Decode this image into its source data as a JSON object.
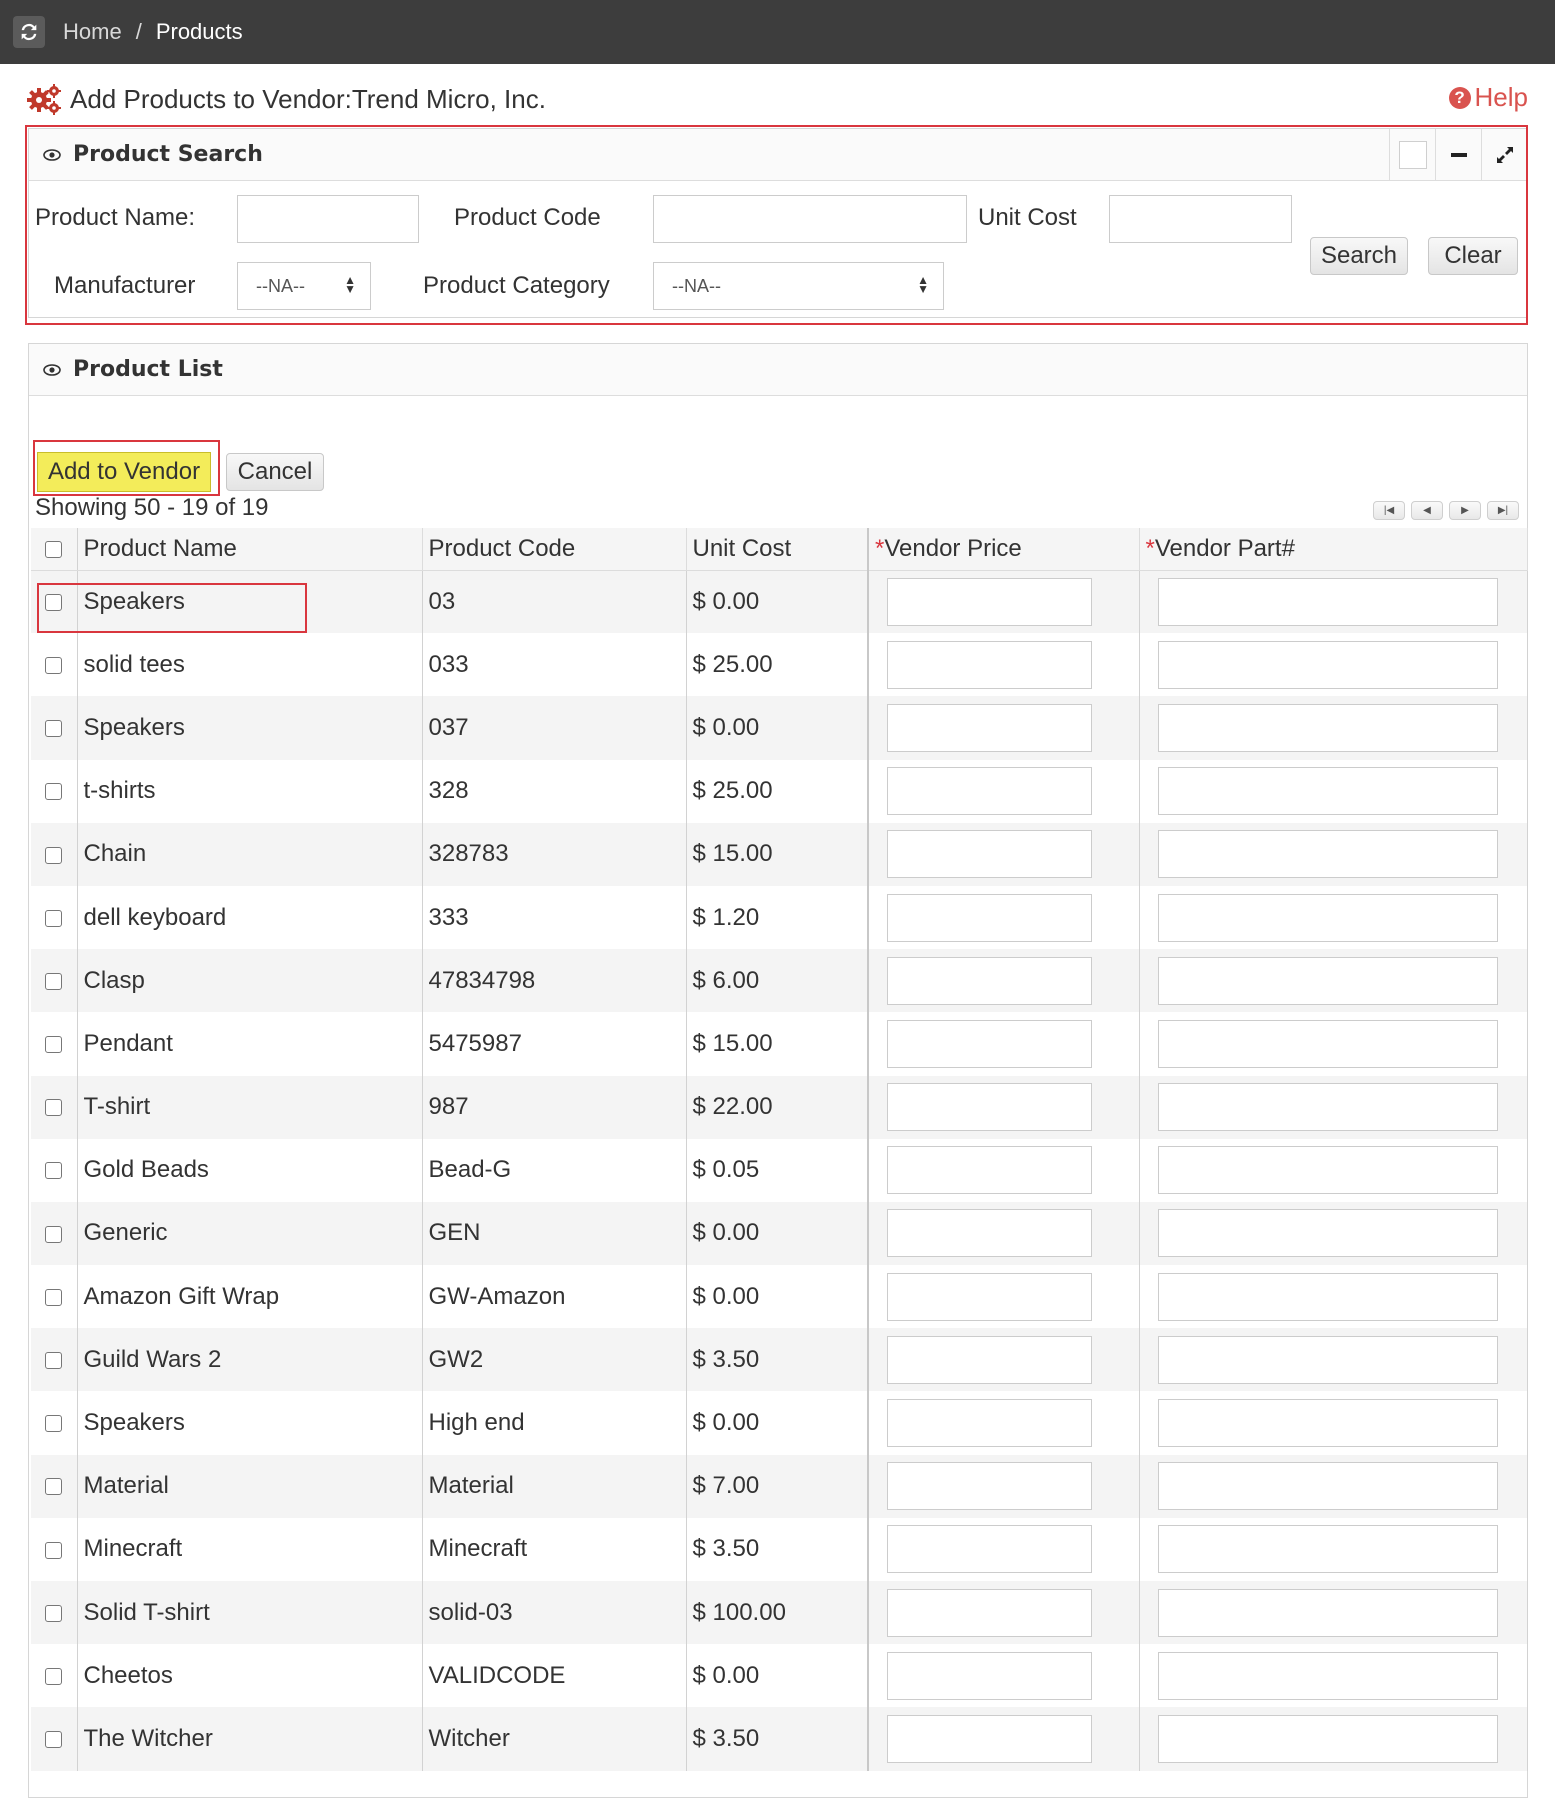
{
  "breadcrumb": {
    "home": "Home",
    "separator": "/",
    "current": "Products"
  },
  "page": {
    "title": "Add Products to Vendor:Trend Micro, Inc.",
    "help": "Help"
  },
  "search_panel": {
    "title": "Product Search",
    "labels": {
      "product_name": "Product Name:",
      "product_code": "Product Code",
      "unit_cost": "Unit Cost",
      "manufacturer": "Manufacturer",
      "product_category": "Product Category"
    },
    "manufacturer_value": "--NA--",
    "category_value": "--NA--",
    "search_button": "Search",
    "clear_button": "Clear"
  },
  "list_panel": {
    "title": "Product List",
    "add_button": "Add to Vendor",
    "cancel_button": "Cancel",
    "showing": "Showing 50 - 19 of 19",
    "columns": {
      "product_name": "Product Name",
      "product_code": "Product Code",
      "unit_cost": "Unit Cost",
      "required_mark": "*",
      "vendor_price": "Vendor Price",
      "vendor_part": "Vendor Part#"
    },
    "rows": [
      {
        "name": "Speakers",
        "code": "03",
        "cost": "$ 0.00"
      },
      {
        "name": "solid tees",
        "code": "033",
        "cost": "$ 25.00"
      },
      {
        "name": "Speakers",
        "code": "037",
        "cost": "$ 0.00"
      },
      {
        "name": "t-shirts",
        "code": "328",
        "cost": "$ 25.00"
      },
      {
        "name": "Chain",
        "code": "328783",
        "cost": "$ 15.00"
      },
      {
        "name": "dell keyboard",
        "code": "333",
        "cost": "$ 1.20"
      },
      {
        "name": "Clasp",
        "code": "47834798",
        "cost": "$ 6.00"
      },
      {
        "name": "Pendant",
        "code": "5475987",
        "cost": "$ 15.00"
      },
      {
        "name": "T-shirt",
        "code": "987",
        "cost": "$ 22.00"
      },
      {
        "name": "Gold Beads",
        "code": "Bead-G",
        "cost": "$ 0.05"
      },
      {
        "name": "Generic",
        "code": "GEN",
        "cost": "$ 0.00"
      },
      {
        "name": "Amazon Gift Wrap",
        "code": "GW-Amazon",
        "cost": "$ 0.00"
      },
      {
        "name": "Guild Wars 2",
        "code": "GW2",
        "cost": "$ 3.50"
      },
      {
        "name": "Speakers",
        "code": "High end",
        "cost": "$ 0.00"
      },
      {
        "name": "Material",
        "code": "Material",
        "cost": "$ 7.00"
      },
      {
        "name": "Minecraft",
        "code": "Minecraft",
        "cost": "$ 3.50"
      },
      {
        "name": "Solid T-shirt",
        "code": "solid-03",
        "cost": "$ 100.00"
      },
      {
        "name": "Cheetos",
        "code": "VALIDCODE",
        "cost": "$ 0.00"
      },
      {
        "name": "The Witcher",
        "code": "Witcher",
        "cost": "$ 3.50"
      }
    ]
  },
  "colors": {
    "topbar": "#3d3d3d",
    "highlight_red": "#d9363e",
    "highlight_yellow": "#f3ec5a",
    "help_red": "#d9534f"
  }
}
